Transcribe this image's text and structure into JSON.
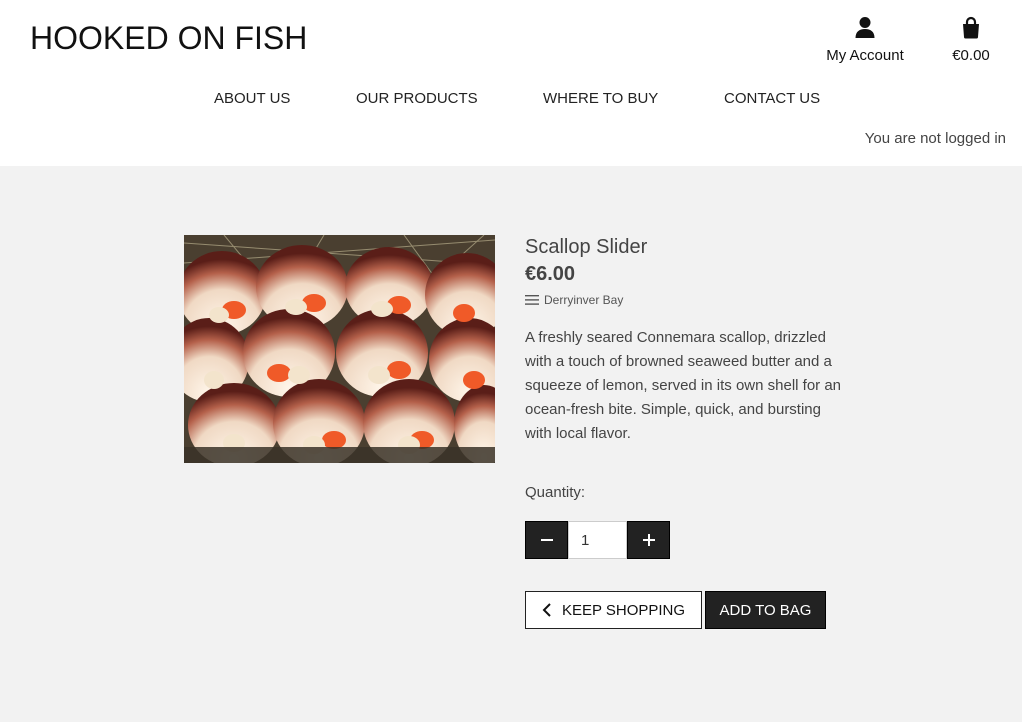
{
  "header": {
    "logo": "HOOKED ON FISH",
    "account_label": "My Account",
    "bag_total": "€0.00",
    "account_icon": "user-icon",
    "bag_icon": "shopping-bag-icon"
  },
  "nav": {
    "items": [
      "ABOUT US",
      "OUR PRODUCTS",
      "WHERE TO BUY",
      "CONTACT US"
    ]
  },
  "login_status": "You are not logged in",
  "product": {
    "name": "Scallop Slider",
    "price": "€6.00",
    "category": "Derryinver Bay",
    "category_icon": "bars-icon",
    "description": "A freshly seared Connemara scallop, drizzled with a touch of browned seaweed butter and a squeeze of lemon, served in its own shell for an ocean-fresh bite. Simple, quick, and bursting with local flavor.",
    "image_subject": "scallops in shells"
  },
  "quantity": {
    "label": "Quantity:",
    "value": "1",
    "minus_icon": "minus-icon",
    "plus_icon": "plus-icon"
  },
  "actions": {
    "keep_shopping": "KEEP SHOPPING",
    "keep_shopping_icon": "chevron-left-icon",
    "add_to_bag": "ADD TO BAG"
  },
  "colors": {
    "page_bg": "#f2f2f2",
    "header_bg": "#ffffff",
    "dark_button": "#222222",
    "text": "#444444"
  }
}
